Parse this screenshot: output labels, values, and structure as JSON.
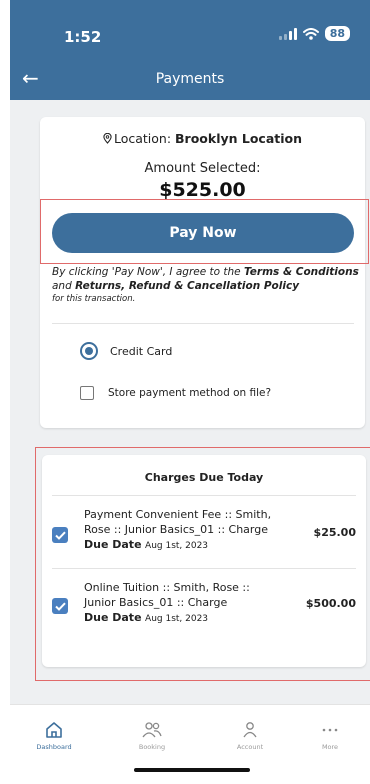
{
  "status_bar": {
    "time": "1:52",
    "battery": "88"
  },
  "header": {
    "title": "Payments",
    "back_icon": "arrow-left-icon"
  },
  "payment_card": {
    "location_label": "Location: ",
    "location_value": "Brooklyn Location",
    "amount_label": "Amount Selected:",
    "amount_value": "$525.00",
    "pay_button": "Pay Now",
    "terms_prefix": "By clicking 'Pay Now', I agree to the ",
    "terms_link1": "Terms & Conditions",
    "terms_and": " and ",
    "terms_link2": "Returns, Refund & Cancellation Policy",
    "terms_suffix": "for this transaction.",
    "method_label": "Credit Card",
    "store_label": "Store payment method on file?"
  },
  "charges": {
    "title": "Charges Due Today",
    "items": [
      {
        "description": "Payment Convenient Fee :: Smith, Rose :: Junior Basics_01 :: Charge",
        "due_label": "Due Date",
        "due_date": "Aug 1st, 2023",
        "amount": "$25.00"
      },
      {
        "description": "Online Tuition :: Smith, Rose :: Junior Basics_01 :: Charge",
        "due_label": "Due Date",
        "due_date": "Aug 1st, 2023",
        "amount": "$500.00"
      }
    ]
  },
  "nav": [
    {
      "label": "Dashboard",
      "icon": "home-icon"
    },
    {
      "label": "Booking",
      "icon": "people-icon"
    },
    {
      "label": "Account",
      "icon": "person-icon"
    },
    {
      "label": "More",
      "icon": "more-dots-icon"
    }
  ],
  "colors": {
    "primary": "#3d6f9c",
    "highlight": "#e06a6a",
    "checkbox": "#4a7fbf"
  }
}
